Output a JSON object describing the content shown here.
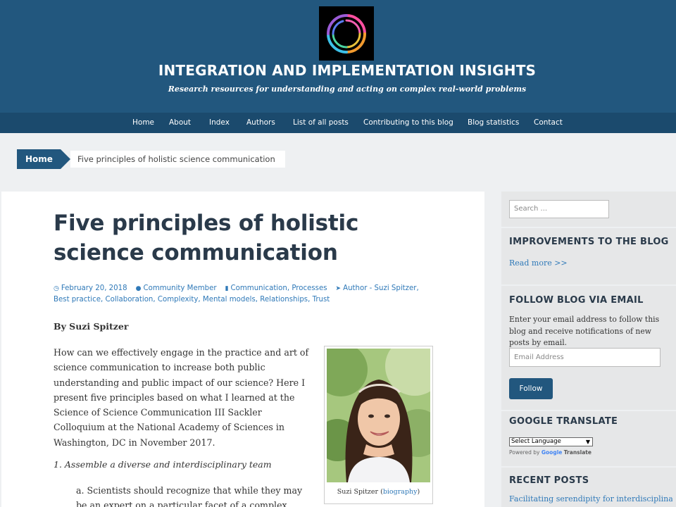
{
  "site": {
    "title": "INTEGRATION AND IMPLEMENTATION INSIGHTS",
    "tagline": "Research resources for understanding and acting on complex real-world problems"
  },
  "nav": {
    "items": [
      {
        "label": "Home"
      },
      {
        "label": "About"
      },
      {
        "label": "Index"
      },
      {
        "label": "Authors"
      },
      {
        "label": "List of all posts"
      },
      {
        "label": "Contributing to this blog"
      },
      {
        "label": "Blog statistics"
      },
      {
        "label": "Contact"
      }
    ]
  },
  "breadcrumb": {
    "home": "Home",
    "current": "Five principles of holistic science communication"
  },
  "post": {
    "title": "Five principles of holistic science communication",
    "meta": {
      "date": "February 20, 2018",
      "author": "Community Member",
      "categories": [
        "Communication",
        "Processes"
      ],
      "tags": [
        "Author - Suzi Spitzer",
        "Best practice",
        "Collaboration",
        "Complexity",
        "Mental models",
        "Relationships",
        "Trust"
      ]
    },
    "byline": "By Suzi Spitzer",
    "intro": "How can we effectively engage in the practice and art of science communication to increase both public understanding and public impact of our science? Here I present five principles based on what I learned at the Science of Science Communication III Sackler Colloquium at the National Academy of Sciences in Washington, DC in November 2017.",
    "principle_1": "1. Assemble a diverse and interdisciplinary team",
    "sub_a": "a. Scientists should recognize that while they may be an expert on a particular facet of a complex",
    "photo": {
      "caption_name": "Suzi Spitzer",
      "caption_link": "biography"
    }
  },
  "sidebar": {
    "search_placeholder": "Search ...",
    "improvements": {
      "title": "IMPROVEMENTS TO THE BLOG",
      "link": "Read more >>"
    },
    "follow": {
      "title": "FOLLOW BLOG VIA EMAIL",
      "text": "Enter your email address to follow this blog and receive notifications of new posts by email.",
      "email_placeholder": "Email Address",
      "button": "Follow"
    },
    "translate": {
      "title": "GOOGLE TRANSLATE",
      "select_label": "Select Language",
      "powered_prefix": "Powered by",
      "powered_google": "Google",
      "powered_translate": "Translate"
    },
    "recent": {
      "title": "RECENT POSTS",
      "first": "Facilitating serendipity for interdisciplinary"
    }
  },
  "colors": {
    "header": "#22577e",
    "nav": "#1b4a6d",
    "link": "#2f79b8",
    "title": "#2a3a4a"
  },
  "icons": {
    "logo": "circular-swirl-logo-icon",
    "date": "clock-icon",
    "author": "user-icon",
    "category": "folder-icon",
    "tag": "tag-icon"
  }
}
